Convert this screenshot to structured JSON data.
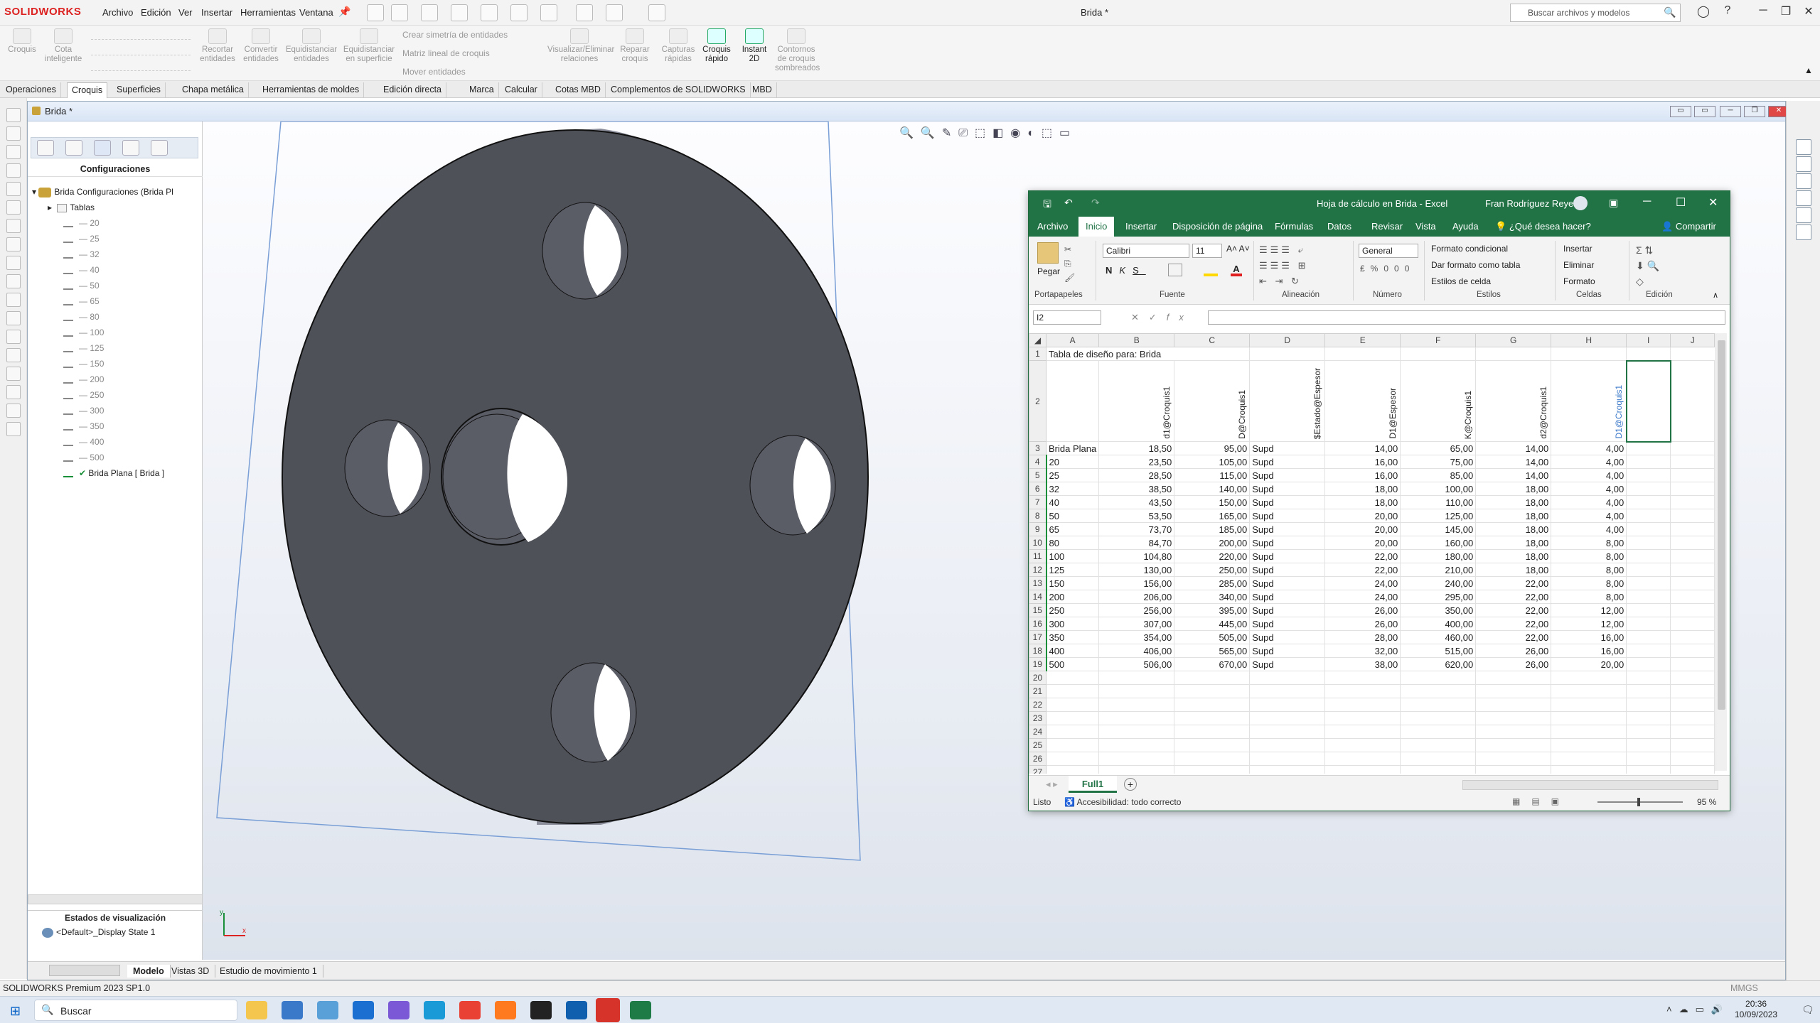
{
  "app": {
    "brand": "SOLIDWORKS",
    "menu": [
      "Archivo",
      "Edición",
      "Ver",
      "Insertar",
      "Herramientas",
      "Ventana"
    ],
    "doc_title": "Brida *",
    "search_placeholder": "Buscar archivos y modelos"
  },
  "commands": {
    "tools": [
      "Croquis",
      "Cota inteligente",
      "Recortar entidades",
      "Convertir entidades",
      "Equidistanciar entidades",
      "Equidistanciar en superficie",
      "Visualizar/Eliminar relaciones",
      "Reparar croquis",
      "Capturas rápidas",
      "Croquis rápido",
      "Instant 2D",
      "Contornos de croquis sombreados"
    ],
    "small": [
      "Crear simetría de entidades",
      "Matriz lineal de croquis",
      "Mover entidades"
    ],
    "tabs": [
      "Operaciones",
      "Croquis",
      "Superficies",
      "Chapa metálica",
      "Herramientas de moldes",
      "Edición directa",
      "Marca",
      "Calcular",
      "Cotas MBD",
      "Complementos de SOLIDWORKS",
      "MBD"
    ],
    "selected_tab": "Croquis"
  },
  "docwin": {
    "title": "Brida *"
  },
  "feature_manager": {
    "heading": "Configuraciones",
    "root": "Brida Configuraciones  (Brida Pl",
    "tables": "Tablas",
    "configs": [
      "20",
      "25",
      "32",
      "40",
      "50",
      "65",
      "80",
      "100",
      "125",
      "150",
      "200",
      "250",
      "300",
      "350",
      "400",
      "500"
    ],
    "active": "Brida Plana [ Brida ]",
    "display_heading": "Estados de visualización",
    "display_state": "<Default>_Display State 1"
  },
  "bottom_tabs": [
    "Modelo",
    "Vistas 3D",
    "Estudio de movimiento 1"
  ],
  "excel": {
    "title": "Hoja de cálculo en Brida  -  Excel",
    "user": "Fran Rodríguez Reyes",
    "menu": [
      "Archivo",
      "Inicio",
      "Insertar",
      "Disposición de página",
      "Fórmulas",
      "Datos",
      "Revisar",
      "Vista",
      "Ayuda",
      "¿Qué desea hacer?",
      "Compartir"
    ],
    "selected_menu": "Inicio",
    "ribbon": {
      "paste": "Pegar",
      "font": "Calibri",
      "size": "11",
      "number_format": "General",
      "styles": [
        "Formato condicional",
        "Dar formato como tabla",
        "Estilos de celda"
      ],
      "cells": [
        "Insertar",
        "Eliminar",
        "Formato"
      ],
      "groups": [
        "Portapapeles",
        "Fuente",
        "Alineación",
        "Número",
        "Estilos",
        "Celdas",
        "Edición"
      ]
    },
    "name_box": "I2",
    "columns": [
      "A",
      "B",
      "C",
      "D",
      "E",
      "F",
      "G",
      "H",
      "I",
      "J"
    ],
    "row1_title": "Tabla de diseño para: Brida",
    "headers": [
      "d1@Croquis1",
      "D@Croquis1",
      "$Estado@Espesor",
      "D1@Espesor",
      "K@Croquis1",
      "d2@Croquis1",
      "D1@Croquis1"
    ],
    "rows": [
      [
        "3",
        "Brida Plana",
        "18,50",
        "95,00",
        "Supd",
        "14,00",
        "65,00",
        "14,00",
        "4,00"
      ],
      [
        "4",
        "20",
        "23,50",
        "105,00",
        "Supd",
        "16,00",
        "75,00",
        "14,00",
        "4,00"
      ],
      [
        "5",
        "25",
        "28,50",
        "115,00",
        "Supd",
        "16,00",
        "85,00",
        "14,00",
        "4,00"
      ],
      [
        "6",
        "32",
        "38,50",
        "140,00",
        "Supd",
        "18,00",
        "100,00",
        "18,00",
        "4,00"
      ],
      [
        "7",
        "40",
        "43,50",
        "150,00",
        "Supd",
        "18,00",
        "110,00",
        "18,00",
        "4,00"
      ],
      [
        "8",
        "50",
        "53,50",
        "165,00",
        "Supd",
        "20,00",
        "125,00",
        "18,00",
        "4,00"
      ],
      [
        "9",
        "65",
        "73,70",
        "185,00",
        "Supd",
        "20,00",
        "145,00",
        "18,00",
        "4,00"
      ],
      [
        "10",
        "80",
        "84,70",
        "200,00",
        "Supd",
        "20,00",
        "160,00",
        "18,00",
        "8,00"
      ],
      [
        "11",
        "100",
        "104,80",
        "220,00",
        "Supd",
        "22,00",
        "180,00",
        "18,00",
        "8,00"
      ],
      [
        "12",
        "125",
        "130,00",
        "250,00",
        "Supd",
        "22,00",
        "210,00",
        "18,00",
        "8,00"
      ],
      [
        "13",
        "150",
        "156,00",
        "285,00",
        "Supd",
        "24,00",
        "240,00",
        "22,00",
        "8,00"
      ],
      [
        "14",
        "200",
        "206,00",
        "340,00",
        "Supd",
        "24,00",
        "295,00",
        "22,00",
        "8,00"
      ],
      [
        "15",
        "250",
        "256,00",
        "395,00",
        "Supd",
        "26,00",
        "350,00",
        "22,00",
        "12,00"
      ],
      [
        "16",
        "300",
        "307,00",
        "445,00",
        "Supd",
        "26,00",
        "400,00",
        "22,00",
        "12,00"
      ],
      [
        "17",
        "350",
        "354,00",
        "505,00",
        "Supd",
        "28,00",
        "460,00",
        "22,00",
        "16,00"
      ],
      [
        "18",
        "400",
        "406,00",
        "565,00",
        "Supd",
        "32,00",
        "515,00",
        "26,00",
        "16,00"
      ],
      [
        "19",
        "500",
        "506,00",
        "670,00",
        "Supd",
        "38,00",
        "620,00",
        "26,00",
        "20,00"
      ]
    ],
    "empty_rows": [
      "20",
      "21",
      "22",
      "23",
      "24",
      "25",
      "26",
      "27"
    ],
    "sheet_tab": "Full1",
    "status_ready": "Listo",
    "status_access": "Accesibilidad: todo correcto",
    "zoom": "95 %"
  },
  "status": {
    "product": "SOLIDWORKS Premium 2023 SP1.0",
    "units": "MMGS"
  },
  "taskbar": {
    "search": "Buscar",
    "time": "20:36",
    "date": "10/09/2023"
  },
  "colors": {
    "excel_green": "#217346",
    "model_gray": "#4f5159",
    "sw_red": "#d22222"
  }
}
